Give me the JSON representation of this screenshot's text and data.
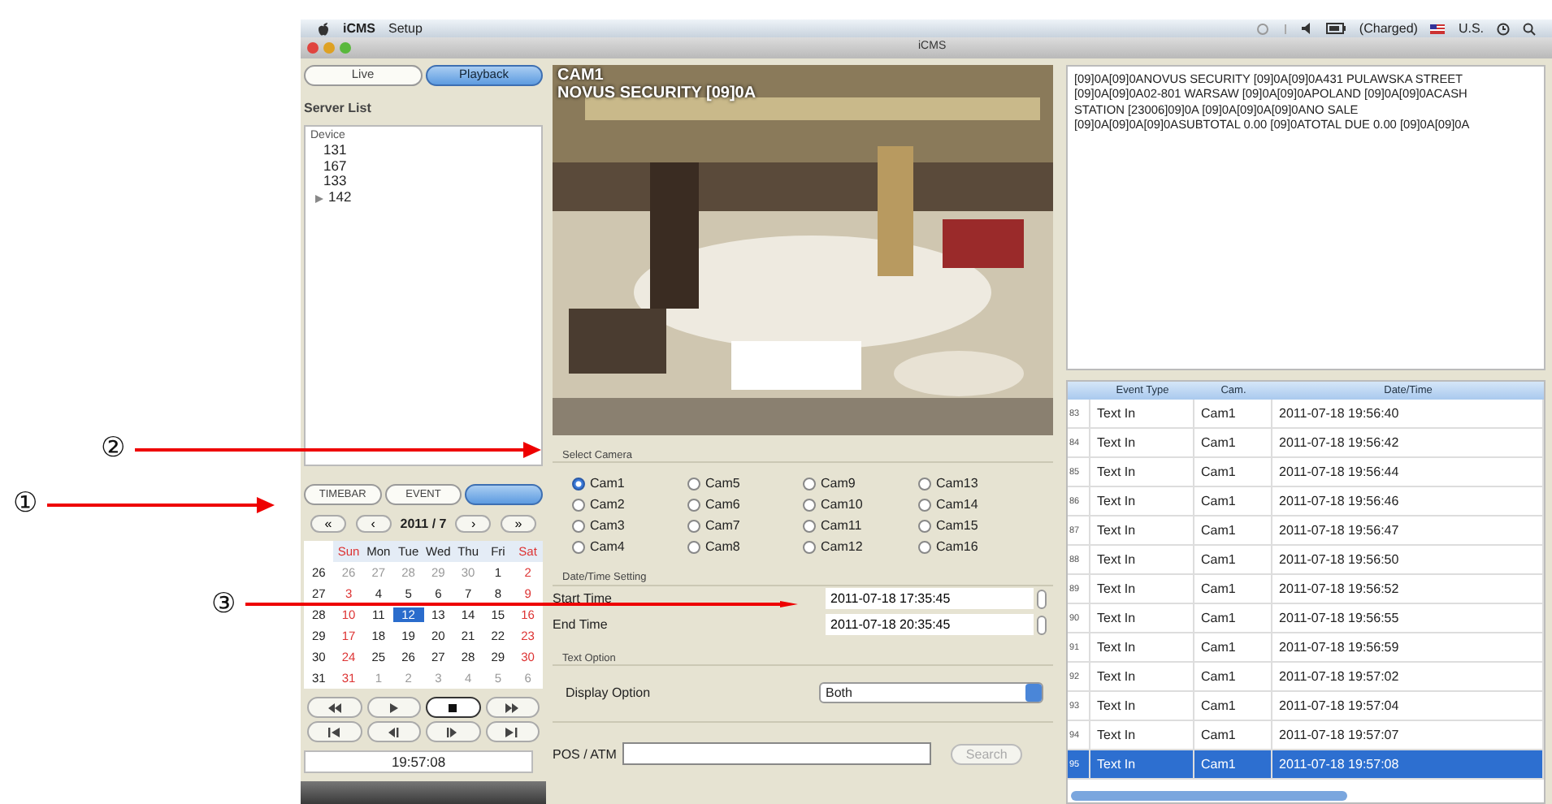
{
  "menubar": {
    "app": "iCMS",
    "menus": [
      "Setup"
    ],
    "battery": "(Charged)",
    "input_source": "U.S."
  },
  "window": {
    "title": "iCMS"
  },
  "mode_tabs": [
    {
      "label": "Live",
      "selected": false
    },
    {
      "label": "Playback",
      "selected": true
    }
  ],
  "server_list": {
    "title": "Server List",
    "header": "Device",
    "items": [
      {
        "label": "131",
        "expandable": false
      },
      {
        "label": "167",
        "expandable": false
      },
      {
        "label": "133",
        "expandable": false
      },
      {
        "label": "142",
        "expandable": true
      }
    ]
  },
  "search_tabs": [
    {
      "label": "TIMEBAR",
      "selected": false
    },
    {
      "label": "EVENT",
      "selected": false
    },
    {
      "selected": true
    }
  ],
  "calendar": {
    "prev_year": "«",
    "prev_month": "‹",
    "title": "2011 / 7",
    "next_month": "›",
    "next_year": "»",
    "weekdays": [
      "Sun",
      "Mon",
      "Tue",
      "Wed",
      "Thu",
      "Fri",
      "Sat"
    ],
    "weeks": [
      {
        "number": "26",
        "days": [
          {
            "text": "26",
            "outside": true,
            "selected": false
          },
          {
            "text": "27",
            "outside": true,
            "selected": false
          },
          {
            "text": "28",
            "outside": true,
            "selected": false
          },
          {
            "text": "29",
            "outside": true,
            "selected": false
          },
          {
            "text": "30",
            "outside": true,
            "selected": false
          },
          {
            "text": "1",
            "outside": false,
            "selected": false
          },
          {
            "text": "2",
            "outside": false,
            "selected": false
          }
        ]
      },
      {
        "number": "27",
        "days": [
          {
            "text": "3",
            "outside": false,
            "selected": false
          },
          {
            "text": "4",
            "outside": false,
            "selected": false
          },
          {
            "text": "5",
            "outside": false,
            "selected": false
          },
          {
            "text": "6",
            "outside": false,
            "selected": false
          },
          {
            "text": "7",
            "outside": false,
            "selected": false
          },
          {
            "text": "8",
            "outside": false,
            "selected": false
          },
          {
            "text": "9",
            "outside": false,
            "selected": false
          }
        ]
      },
      {
        "number": "28",
        "days": [
          {
            "text": "10",
            "outside": false,
            "selected": false
          },
          {
            "text": "11",
            "outside": false,
            "selected": false
          },
          {
            "text": "12",
            "outside": false,
            "selected": true
          },
          {
            "text": "13",
            "outside": false,
            "selected": false
          },
          {
            "text": "14",
            "outside": false,
            "selected": false
          },
          {
            "text": "15",
            "outside": false,
            "selected": false
          },
          {
            "text": "16",
            "outside": false,
            "selected": false
          }
        ]
      },
      {
        "number": "29",
        "days": [
          {
            "text": "17",
            "outside": false,
            "selected": false
          },
          {
            "text": "18",
            "outside": false,
            "selected": false
          },
          {
            "text": "19",
            "outside": false,
            "selected": false
          },
          {
            "text": "20",
            "outside": false,
            "selected": false
          },
          {
            "text": "21",
            "outside": false,
            "selected": false
          },
          {
            "text": "22",
            "outside": false,
            "selected": false
          },
          {
            "text": "23",
            "outside": false,
            "selected": false
          }
        ]
      },
      {
        "number": "30",
        "days": [
          {
            "text": "24",
            "outside": false,
            "selected": false
          },
          {
            "text": "25",
            "outside": false,
            "selected": false
          },
          {
            "text": "26",
            "outside": false,
            "selected": false
          },
          {
            "text": "27",
            "outside": false,
            "selected": false
          },
          {
            "text": "28",
            "outside": false,
            "selected": false
          },
          {
            "text": "29",
            "outside": false,
            "selected": false
          },
          {
            "text": "30",
            "outside": false,
            "selected": false
          }
        ]
      },
      {
        "number": "31",
        "days": [
          {
            "text": "31",
            "outside": false,
            "selected": false
          },
          {
            "text": "1",
            "outside": true,
            "selected": false
          },
          {
            "text": "2",
            "outside": true,
            "selected": false
          },
          {
            "text": "3",
            "outside": true,
            "selected": false
          },
          {
            "text": "4",
            "outside": true,
            "selected": false
          },
          {
            "text": "5",
            "outside": true,
            "selected": false
          },
          {
            "text": "6",
            "outside": true,
            "selected": false
          }
        ]
      }
    ]
  },
  "player": {
    "buttons": [
      {
        "kind": "rewind",
        "selected": false
      },
      {
        "kind": "play",
        "selected": false
      },
      {
        "kind": "stop",
        "selected": true
      },
      {
        "kind": "fast_forward",
        "selected": false
      },
      {
        "kind": "skip_start",
        "selected": false
      },
      {
        "kind": "step_back",
        "selected": false
      },
      {
        "kind": "step_forward",
        "selected": false
      },
      {
        "kind": "skip_end",
        "selected": false
      }
    ]
  },
  "clock": "19:57:08",
  "video": {
    "camera": "CAM1",
    "overlay": "NOVUS SECURITY [09]0A"
  },
  "select_camera": {
    "title": "Select Camera",
    "cameras": [
      {
        "label": "Cam1",
        "selected": true
      },
      {
        "label": "Cam2",
        "selected": false
      },
      {
        "label": "Cam3",
        "selected": false
      },
      {
        "label": "Cam4",
        "selected": false
      },
      {
        "label": "Cam5",
        "selected": false
      },
      {
        "label": "Cam6",
        "selected": false
      },
      {
        "label": "Cam7",
        "selected": false
      },
      {
        "label": "Cam8",
        "selected": false
      },
      {
        "label": "Cam9",
        "selected": false
      },
      {
        "label": "Cam10",
        "selected": false
      },
      {
        "label": "Cam11",
        "selected": false
      },
      {
        "label": "Cam12",
        "selected": false
      },
      {
        "label": "Cam13",
        "selected": false
      },
      {
        "label": "Cam14",
        "selected": false
      },
      {
        "label": "Cam15",
        "selected": false
      },
      {
        "label": "Cam16",
        "selected": false
      }
    ]
  },
  "datetime": {
    "title": "Date/Time Setting",
    "start_label": "Start Time",
    "start": "2011-07-18 17:35:45",
    "end_label": "End Time",
    "end": "2011-07-18 20:35:45"
  },
  "text_option": {
    "title": "Text Option",
    "display_label": "Display Option",
    "display_value": "Both"
  },
  "pos_search": {
    "label": "POS / ATM",
    "button": "Search",
    "button_disabled": true
  },
  "text_log": [
    "[09]0A[09]0ANOVUS SECURITY [09]0A[09]0A431 PULAWSKA STREET",
    "[09]0A[09]0A02-801 WARSAW [09]0A[09]0APOLAND [09]0A[09]0ACASH",
    "STATION [23006]09]0A [09]0A[09]0A[09]0ANO SALE",
    "[09]0A[09]0A[09]0ASUBTOTAL 0.00 [09]0ATOTAL DUE 0.00 [09]0A[09]0A"
  ],
  "events": {
    "columns": [
      "Event Type",
      "Cam.",
      "Date/Time"
    ],
    "rows": [
      {
        "number": "83",
        "event_type": "Text In",
        "cam": "Cam1",
        "date_time": "2011-07-18 19:56:40",
        "selected": false
      },
      {
        "number": "84",
        "event_type": "Text In",
        "cam": "Cam1",
        "date_time": "2011-07-18 19:56:42",
        "selected": false
      },
      {
        "number": "85",
        "event_type": "Text In",
        "cam": "Cam1",
        "date_time": "2011-07-18 19:56:44",
        "selected": false
      },
      {
        "number": "86",
        "event_type": "Text In",
        "cam": "Cam1",
        "date_time": "2011-07-18 19:56:46",
        "selected": false
      },
      {
        "number": "87",
        "event_type": "Text In",
        "cam": "Cam1",
        "date_time": "2011-07-18 19:56:47",
        "selected": false
      },
      {
        "number": "88",
        "event_type": "Text In",
        "cam": "Cam1",
        "date_time": "2011-07-18 19:56:50",
        "selected": false
      },
      {
        "number": "89",
        "event_type": "Text In",
        "cam": "Cam1",
        "date_time": "2011-07-18 19:56:52",
        "selected": false
      },
      {
        "number": "90",
        "event_type": "Text In",
        "cam": "Cam1",
        "date_time": "2011-07-18 19:56:55",
        "selected": false
      },
      {
        "number": "91",
        "event_type": "Text In",
        "cam": "Cam1",
        "date_time": "2011-07-18 19:56:59",
        "selected": false
      },
      {
        "number": "92",
        "event_type": "Text In",
        "cam": "Cam1",
        "date_time": "2011-07-18 19:57:02",
        "selected": false
      },
      {
        "number": "93",
        "event_type": "Text In",
        "cam": "Cam1",
        "date_time": "2011-07-18 19:57:04",
        "selected": false
      },
      {
        "number": "94",
        "event_type": "Text In",
        "cam": "Cam1",
        "date_time": "2011-07-18 19:57:07",
        "selected": false
      },
      {
        "number": "95",
        "event_type": "Text In",
        "cam": "Cam1",
        "date_time": "2011-07-18 19:57:08",
        "selected": true
      }
    ]
  },
  "callouts": [
    {
      "label": "②"
    },
    {
      "label": "①"
    },
    {
      "label": "③"
    }
  ]
}
